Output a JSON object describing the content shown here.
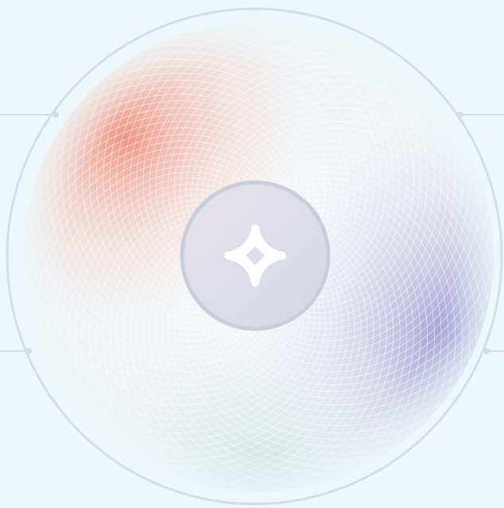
{
  "hero": {
    "icon": "sparkle-star-icon",
    "colors": {
      "background": "#eef8fa",
      "outer_ring": "#cfe1e3",
      "orb_base": "#eef2f4",
      "warm_accent": "#f07a63",
      "cool_accent": "#8a86c9",
      "lower_tint": "#cde0de",
      "hub": "#dde1ea",
      "hub_ring": "#c9ced8",
      "mesh_lines": "#ffffff",
      "star": "#ffffff"
    }
  }
}
